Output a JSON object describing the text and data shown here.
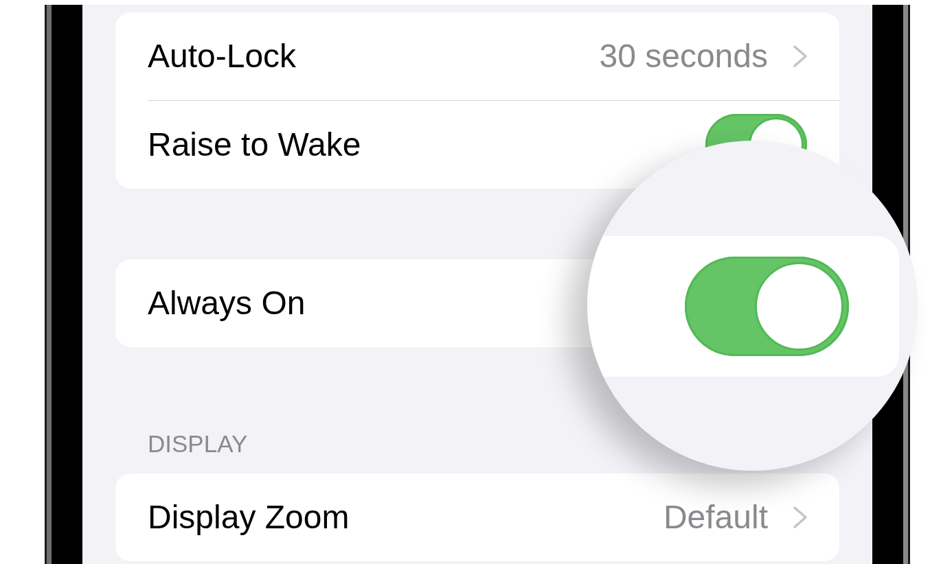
{
  "groups": [
    {
      "rows": [
        {
          "kind": "link",
          "label": "Auto-Lock",
          "value": "30 seconds"
        },
        {
          "kind": "toggle",
          "label": "Raise to Wake",
          "on": true,
          "magnified": false
        }
      ]
    },
    {
      "rows": [
        {
          "kind": "toggle",
          "label": "Always On",
          "on": true,
          "magnified": true
        }
      ]
    },
    {
      "header": "DISPLAY",
      "rows": [
        {
          "kind": "link",
          "label": "Display Zoom",
          "value": "Default"
        }
      ]
    }
  ]
}
